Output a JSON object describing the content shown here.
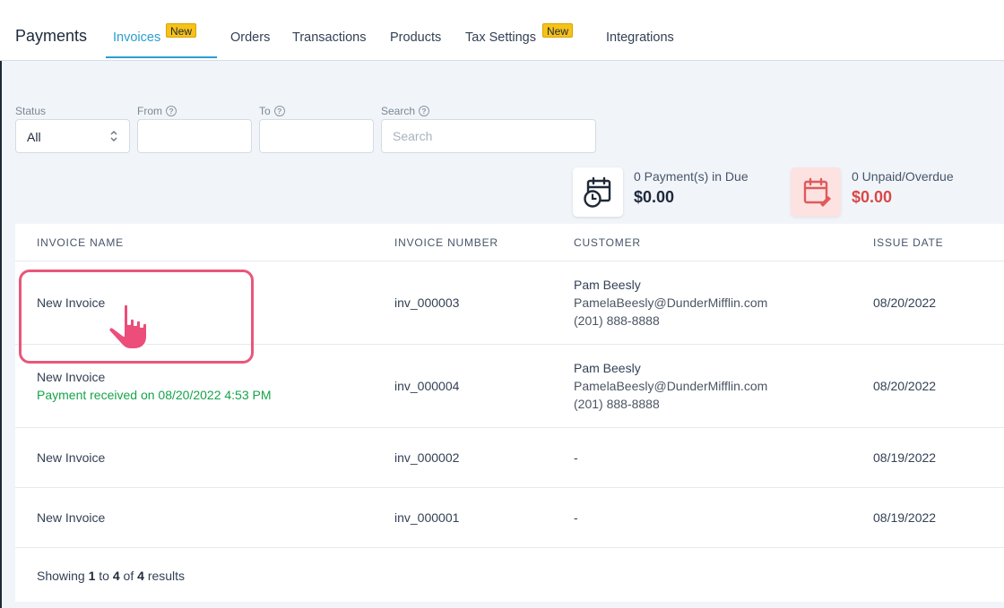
{
  "header": {
    "title": "Payments",
    "tabs": [
      {
        "label": "Invoices",
        "badge": "New",
        "active": true
      },
      {
        "label": "Orders"
      },
      {
        "label": "Transactions"
      },
      {
        "label": "Products"
      },
      {
        "label": "Tax Settings",
        "badge": "New"
      },
      {
        "label": "Integrations"
      }
    ]
  },
  "filters": {
    "status": {
      "label": "Status",
      "value": "All"
    },
    "from": {
      "label": "From",
      "value": ""
    },
    "to": {
      "label": "To",
      "value": ""
    },
    "search": {
      "label": "Search",
      "placeholder": "Search",
      "value": ""
    }
  },
  "stats": {
    "due": {
      "count_label": "0  Payment(s) in Due",
      "amount": "$0.00",
      "icon": "calendar-clock-icon"
    },
    "unpaid": {
      "count_label": "0  Unpaid/Overdue",
      "amount": "$0.00",
      "icon": "calendar-edit-icon",
      "color": "#d94848"
    }
  },
  "table": {
    "columns": [
      "INVOICE NAME",
      "INVOICE NUMBER",
      "CUSTOMER",
      "ISSUE DATE"
    ],
    "rows": [
      {
        "name": "New Invoice",
        "note": "",
        "number": "inv_000003",
        "customer_name": "Pam Beesly",
        "customer_email": "PamelaBeesly@DunderMifflin.com",
        "customer_phone": "(201) 888-8888",
        "issue_date": "08/20/2022"
      },
      {
        "name": "New Invoice",
        "note": "Payment received on 08/20/2022 4:53 PM",
        "number": "inv_000004",
        "customer_name": "Pam Beesly",
        "customer_email": "PamelaBeesly@DunderMifflin.com",
        "customer_phone": "(201) 888-8888",
        "issue_date": "08/20/2022"
      },
      {
        "name": "New Invoice",
        "note": "",
        "number": "inv_000002",
        "customer_name": "-",
        "customer_email": "",
        "customer_phone": "",
        "issue_date": "08/19/2022"
      },
      {
        "name": "New Invoice",
        "note": "",
        "number": "inv_000001",
        "customer_name": "-",
        "customer_email": "",
        "customer_phone": "",
        "issue_date": "08/19/2022"
      }
    ],
    "footer": {
      "prefix": "Showing",
      "from": "1",
      "to_word": "to",
      "to": "4",
      "of_word": "of",
      "total": "4",
      "suffix": "results"
    }
  },
  "colors": {
    "accent": "#2a9fd0",
    "badge": "#f6c21a",
    "success": "#16a34a",
    "danger": "#d94848",
    "highlight": "#e8577a"
  }
}
